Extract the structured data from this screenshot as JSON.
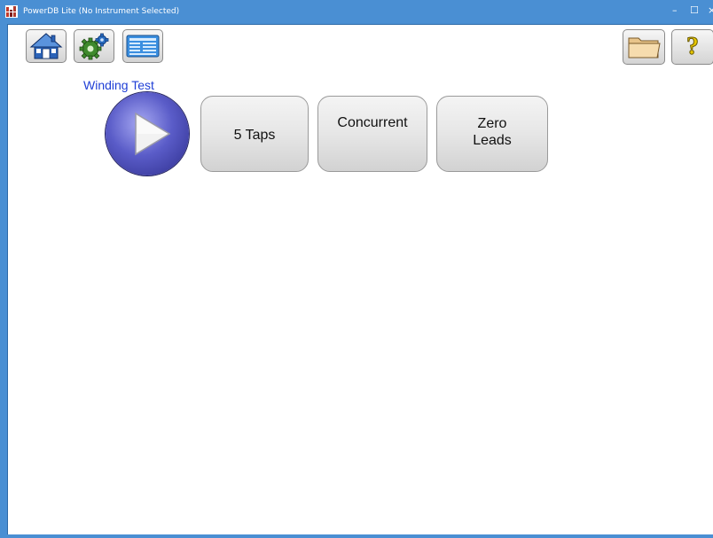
{
  "window": {
    "title": "PowerDB Lite (No Instrument Selected)",
    "controls": {
      "minimize": "–",
      "maximize": "☐",
      "close": "×"
    }
  },
  "toolbar": {
    "left": [
      {
        "icon": "home-icon"
      },
      {
        "icon": "gear-icon"
      },
      {
        "icon": "instrument-card-icon"
      }
    ],
    "right": [
      {
        "icon": "folder-icon"
      },
      {
        "icon": "help-icon",
        "glyph": "?"
      }
    ]
  },
  "test": {
    "label": "Winding Test",
    "play_icon": "play-icon"
  },
  "buttons": [
    {
      "label": "5 Taps"
    },
    {
      "label": "Concurrent"
    },
    {
      "label": "Zero\nLeads"
    }
  ],
  "colors": {
    "titlebar": "#4a8fd3",
    "winding_label": "#1f3fd6",
    "play_inner": "#5a5cc8"
  }
}
